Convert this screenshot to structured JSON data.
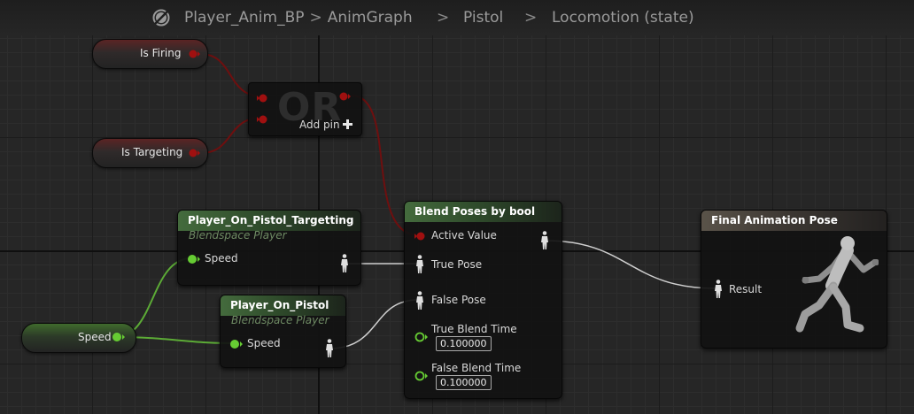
{
  "breadcrumb": {
    "items": [
      "Player_Anim_BP",
      "AnimGraph",
      "Pistol",
      "Locomotion (state)"
    ],
    "separator": ">"
  },
  "colors": {
    "bool_pin": "#a01010",
    "float_pin": "#66cc33",
    "pose_pin": "#e0e0e0",
    "bool_wire": "#6e0f0f",
    "float_wire": "#5cab36",
    "pose_wire": "#cfcfcf"
  },
  "variables": {
    "is_firing": "Is Firing",
    "is_targeting": "Is Targeting",
    "speed": "Speed"
  },
  "or_node": {
    "title": "OR",
    "add_pin_label": "Add pin",
    "add_pin_icon": "plus-icon"
  },
  "blendspace_targetting": {
    "title": "Player_On_Pistol_Targetting",
    "subtitle": "Blendspace Player",
    "input_label": "Speed"
  },
  "blendspace_pistol": {
    "title": "Player_On_Pistol",
    "subtitle": "Blendspace Player",
    "input_label": "Speed"
  },
  "blend_node": {
    "title": "Blend Poses by bool",
    "active_value_label": "Active Value",
    "true_pose_label": "True Pose",
    "false_pose_label": "False Pose",
    "true_blend_time_label": "True Blend Time",
    "true_blend_time_value": "0.100000",
    "false_blend_time_label": "False Blend Time",
    "false_blend_time_value": "0.100000"
  },
  "final_pose": {
    "title": "Final Animation Pose",
    "result_label": "Result",
    "figure": "running-mannequin-icon"
  }
}
